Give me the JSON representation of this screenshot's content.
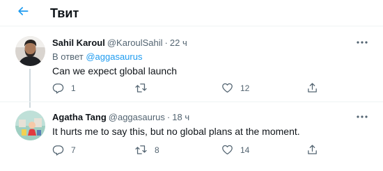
{
  "header": {
    "title": "Твит",
    "back_icon": "arrow-left-icon",
    "accent": "#1d9bf0"
  },
  "tweets": [
    {
      "name": "Sahil Karoul",
      "handle": "@KaroulSahil",
      "separator": "·",
      "time": "22 ч",
      "reply_prefix": "В ответ",
      "reply_to": "@aggasaurus",
      "text": "Can we expect global launch",
      "reply_count": "1",
      "retweet_count": "",
      "like_count": "12"
    },
    {
      "name": "Agatha Tang",
      "handle": "@aggasaurus",
      "separator": "·",
      "time": "18 ч",
      "text": "It hurts me to say this, but no global plans at the moment.",
      "reply_count": "7",
      "retweet_count": "8",
      "like_count": "14"
    }
  ],
  "colors": {
    "text": "#0f1419",
    "secondary": "#536471",
    "link": "#1d9bf0",
    "divider": "#eff3f4"
  }
}
